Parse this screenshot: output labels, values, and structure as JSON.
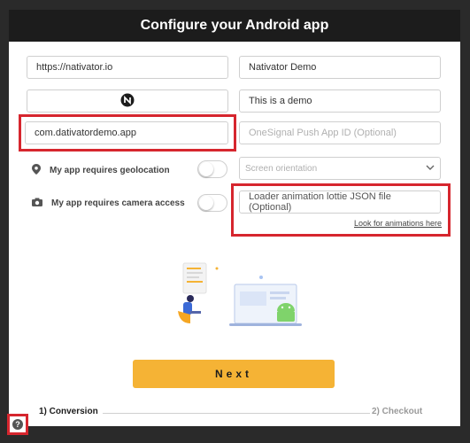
{
  "header": {
    "title": "Configure your Android app"
  },
  "form": {
    "url": "https://nativator.io",
    "app_name": "Nativator Demo",
    "description": "This is a demo",
    "package_id": "com.dativatordemo.app",
    "onesignal_placeholder": "OneSignal Push App ID (Optional)",
    "geolocation_label": "My app requires geolocation",
    "camera_label": "My app requires camera access",
    "orientation_placeholder": "Screen orientation",
    "loader_placeholder": "Loader animation lottie JSON file (Optional)",
    "animations_link": "Look for animations here",
    "geolocation_enabled": false,
    "camera_enabled": false
  },
  "actions": {
    "next_label": "Next"
  },
  "steps": {
    "step1": "1) Conversion",
    "step2": "2) Checkout"
  },
  "help": {
    "symbol": "?"
  },
  "colors": {
    "accent": "#f5b335",
    "highlight": "#d6262e",
    "header_bg": "#1c1c1c"
  }
}
